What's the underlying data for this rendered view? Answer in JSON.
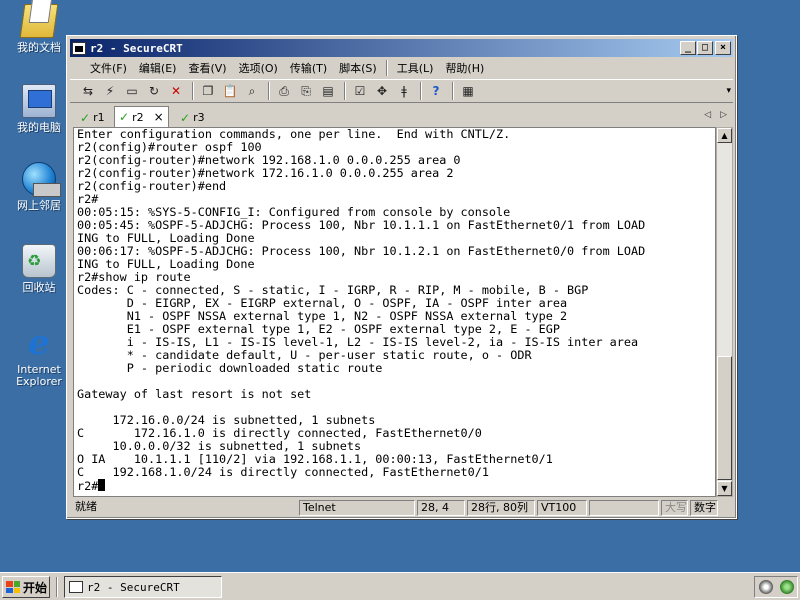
{
  "desktop": {
    "icons": [
      {
        "label": "我的文档",
        "icon": "my-documents-icon"
      },
      {
        "label": "我的电脑",
        "icon": "my-computer-icon"
      },
      {
        "label": "网上邻居",
        "icon": "network-places-icon"
      },
      {
        "label": "回收站",
        "icon": "recycle-bin-icon"
      },
      {
        "label": "Internet Explorer",
        "icon": "internet-explorer-icon"
      }
    ]
  },
  "window": {
    "title": "r2 - SecureCRT",
    "controls": {
      "minimize": "_",
      "maximize": "□",
      "close": "×"
    }
  },
  "menu": [
    "文件(F)",
    "编辑(E)",
    "查看(V)",
    "选项(O)",
    "传输(T)",
    "脚本(S)",
    "工具(L)",
    "帮助(H)"
  ],
  "tabs": [
    {
      "label": "r1",
      "active": false
    },
    {
      "label": "r2",
      "active": true,
      "close": "×"
    },
    {
      "label": "r3",
      "active": false
    }
  ],
  "tab_nav": {
    "left": "◁",
    "right": "▷"
  },
  "terminal": {
    "lines": [
      "Enter configuration commands, one per line.  End with CNTL/Z.",
      "r2(config)#router ospf 100",
      "r2(config-router)#network 192.168.1.0 0.0.0.255 area 0",
      "r2(config-router)#network 172.16.1.0 0.0.0.255 area 2",
      "r2(config-router)#end",
      "r2#",
      "00:05:15: %SYS-5-CONFIG_I: Configured from console by console",
      "00:05:45: %OSPF-5-ADJCHG: Process 100, Nbr 10.1.1.1 on FastEthernet0/1 from LOAD",
      "ING to FULL, Loading Done",
      "00:06:17: %OSPF-5-ADJCHG: Process 100, Nbr 10.1.2.1 on FastEthernet0/0 from LOAD",
      "ING to FULL, Loading Done",
      "r2#show ip route",
      "Codes: C - connected, S - static, I - IGRP, R - RIP, M - mobile, B - BGP",
      "       D - EIGRP, EX - EIGRP external, O - OSPF, IA - OSPF inter area",
      "       N1 - OSPF NSSA external type 1, N2 - OSPF NSSA external type 2",
      "       E1 - OSPF external type 1, E2 - OSPF external type 2, E - EGP",
      "       i - IS-IS, L1 - IS-IS level-1, L2 - IS-IS level-2, ia - IS-IS inter area",
      "       * - candidate default, U - per-user static route, o - ODR",
      "       P - periodic downloaded static route",
      "",
      "Gateway of last resort is not set",
      "",
      "     172.16.0.0/24 is subnetted, 1 subnets",
      "C       172.16.1.0 is directly connected, FastEthernet0/0",
      "     10.0.0.0/32 is subnetted, 1 subnets",
      "O IA    10.1.1.1 [110/2] via 192.168.1.1, 00:00:13, FastEthernet0/1",
      "C    192.168.1.0/24 is directly connected, FastEthernet0/1"
    ],
    "prompt": "r2#"
  },
  "status": {
    "ready": "就绪",
    "protocol": "Telnet",
    "cursor": "28,  4",
    "size": "28行, 80列",
    "emulation": "VT100",
    "caps": "大写",
    "num": "数字"
  },
  "taskbar": {
    "start": "开始",
    "task": "r2 - SecureCRT"
  }
}
